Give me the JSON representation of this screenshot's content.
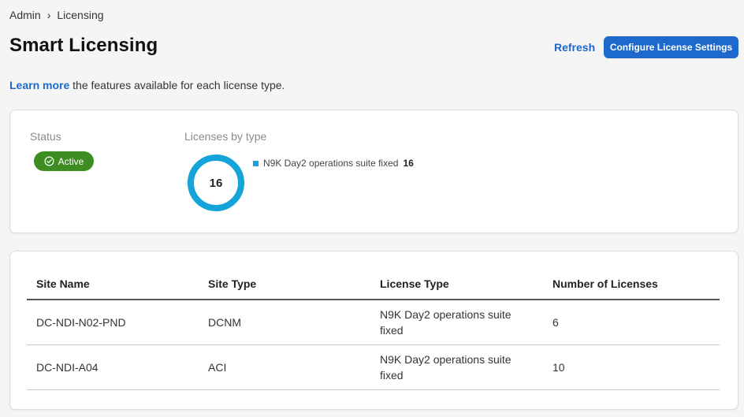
{
  "breadcrumb": {
    "root": "Admin",
    "separator": "›",
    "current": "Licensing"
  },
  "header": {
    "title": "Smart Licensing",
    "refresh_label": "Refresh",
    "configure_label": "Configure License Settings"
  },
  "info": {
    "learn_more": "Learn more",
    "suffix": " the features available for each license type."
  },
  "status": {
    "label": "Status",
    "badge": "Active",
    "color": "#3d8d22"
  },
  "licenses_by_type": {
    "label": "Licenses by type",
    "total": "16",
    "accent": "#14a4d9",
    "legend": [
      {
        "name": "N9K Day2 operations suite fixed",
        "count": "16"
      }
    ]
  },
  "table": {
    "columns": [
      "Site Name",
      "Site Type",
      "License Type",
      "Number of Licenses"
    ],
    "rows": [
      {
        "site_name": "DC-NDI-N02-PND",
        "site_type": "DCNM",
        "license_type": "N9K Day2 operations suite fixed",
        "count": "6"
      },
      {
        "site_name": "DC-NDI-A04",
        "site_type": "ACI",
        "license_type": "N9K Day2 operations suite fixed",
        "count": "10"
      }
    ]
  },
  "accent_color": "#1d69cc"
}
